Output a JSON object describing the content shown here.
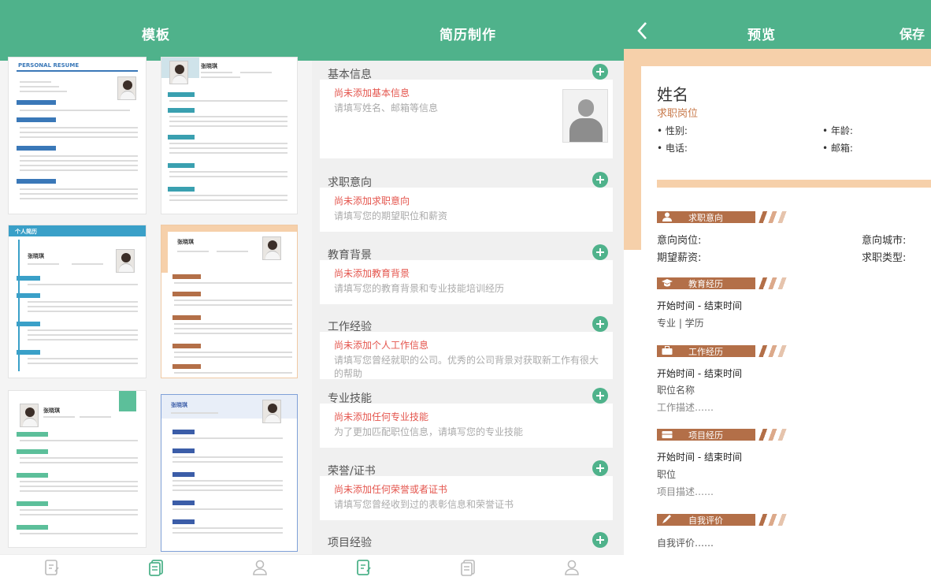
{
  "template_page": {
    "title": "模板",
    "templates": [
      {
        "heading": "PERSONAL  RESUME",
        "name": "张晓琪"
      },
      {
        "heading": "",
        "name": "张晓琪"
      },
      {
        "heading": "个人简历",
        "name": "张晓琪"
      },
      {
        "heading": "",
        "name": "张晓琪"
      },
      {
        "heading": "",
        "name": "张晓琪"
      },
      {
        "heading": "",
        "name": "张晓琪"
      }
    ]
  },
  "editor_page": {
    "title": "简历制作",
    "sections": [
      {
        "title": "基本信息",
        "empty": "尚未添加基本信息",
        "hint": "请填写姓名、邮箱等信息"
      },
      {
        "title": "求职意向",
        "empty": "尚未添加求职意向",
        "hint": "请填写您的期望职位和薪资"
      },
      {
        "title": "教育背景",
        "empty": "尚未添加教育背景",
        "hint": "请填写您的教育背景和专业技能培训经历"
      },
      {
        "title": "工作经验",
        "empty": "尚未添加个人工作信息",
        "hint": "请填写您曾经就职的公司。优秀的公司背景对获取新工作有很大的帮助"
      },
      {
        "title": "专业技能",
        "empty": "尚未添加任何专业技能",
        "hint": "为了更加匹配职位信息，请填写您的专业技能"
      },
      {
        "title": "荣誉/证书",
        "empty": "尚未添加任何荣誉或者证书",
        "hint": "请填写您曾经收到过的表彰信息和荣誉证书"
      },
      {
        "title": "项目经验",
        "empty": "",
        "hint": ""
      }
    ]
  },
  "preview_page": {
    "title": "预览",
    "save_label": "保存",
    "name": "姓名",
    "position": "求职岗位",
    "gender_label": "• 性别:",
    "age_label": "• 年龄:",
    "phone_label": "• 电话:",
    "email_label": "• 邮箱:",
    "intent": {
      "heading": "求职意向",
      "target_job": "意向岗位:",
      "target_city": "意向城市:",
      "salary": "期望薪资:",
      "job_type": "求职类型:"
    },
    "education": {
      "heading": "教育经历",
      "period": "开始时间 - 结束时间",
      "detail": "专业 | 学历"
    },
    "work": {
      "heading": "工作经历",
      "period": "开始时间 - 结束时间",
      "role": "职位名称",
      "desc": "工作描述……"
    },
    "project": {
      "heading": "项目经历",
      "period": "开始时间 - 结束时间",
      "role": "职位",
      "desc": "项目描述……"
    },
    "self_eval": {
      "heading": "自我评价",
      "text": "自我评价……"
    }
  },
  "colors": {
    "primary": "#4fb28b",
    "accent_orange": "#f6d0aa",
    "section_brown": "#b36f48",
    "warn_red": "#e4554d"
  }
}
